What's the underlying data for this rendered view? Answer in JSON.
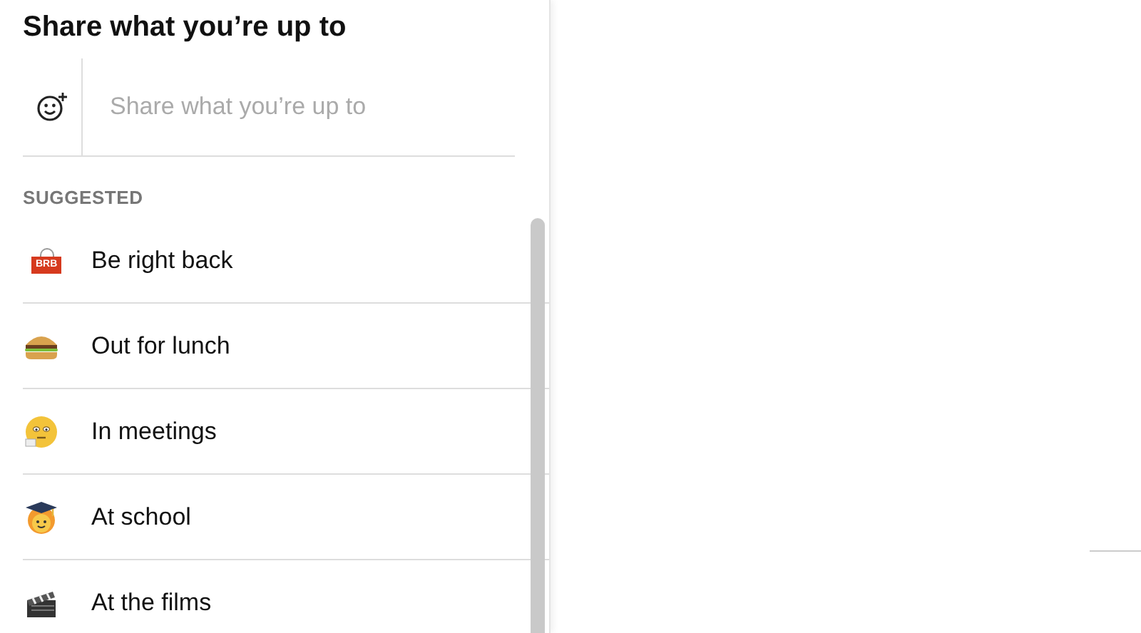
{
  "panel": {
    "title": "Share what you’re up to",
    "status_field": {
      "placeholder": "Share what you’re up to"
    },
    "section_label": "SUGGESTED",
    "suggestions": [
      {
        "kind": "sign",
        "sign_text": "BRB",
        "label": "Be right back"
      },
      {
        "kind": "burger",
        "label": "Out for lunch"
      },
      {
        "kind": "face",
        "label": "In meetings"
      },
      {
        "kind": "graduate",
        "label": "At school"
      },
      {
        "kind": "clapper",
        "label": "At the films"
      }
    ]
  }
}
